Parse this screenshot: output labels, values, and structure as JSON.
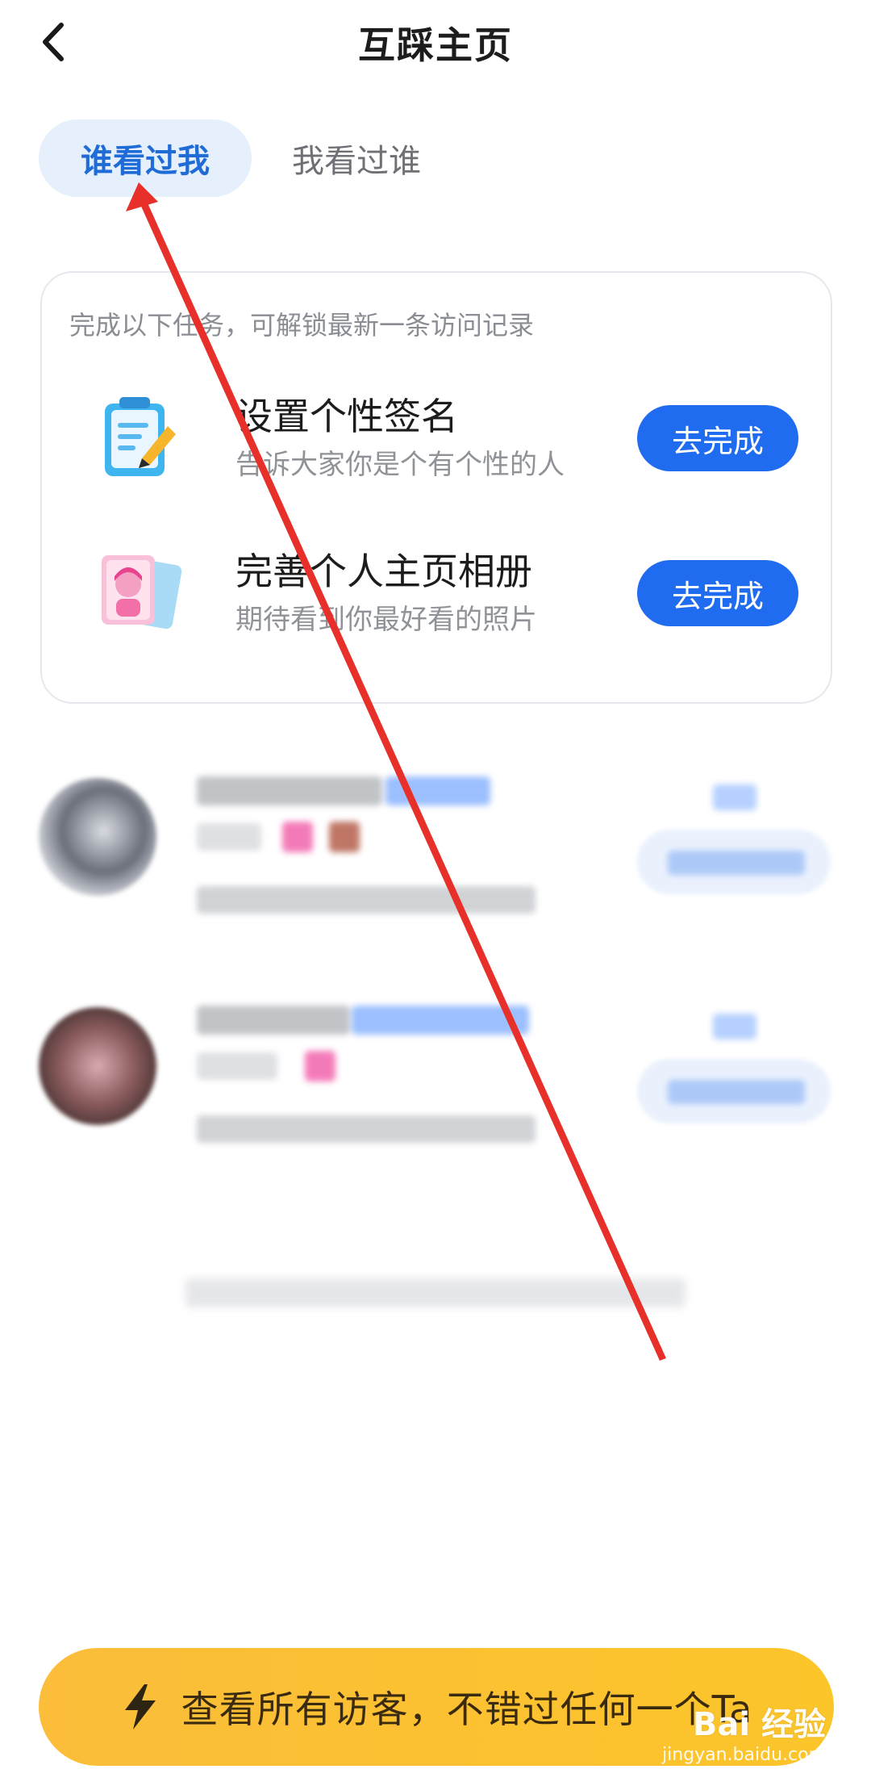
{
  "header": {
    "title": "互踩主页",
    "back_icon": "chevron-left-icon"
  },
  "tabs": [
    {
      "label": "谁看过我",
      "active": true
    },
    {
      "label": "我看过谁",
      "active": false
    }
  ],
  "task_card": {
    "tip": "完成以下任务，可解锁最新一条访问记录",
    "tasks": [
      {
        "title": "设置个性签名",
        "subtitle": "告诉大家你是个有个性的人",
        "button": "去完成",
        "icon": "edit-note-icon"
      },
      {
        "title": "完善个人主页相册",
        "subtitle": "期待看到你最好看的照片",
        "button": "去完成",
        "icon": "photo-album-icon"
      }
    ]
  },
  "cta": {
    "label": "查看所有访客，不错过任何一个Ta",
    "icon": "lightning-icon"
  },
  "watermark": {
    "main": "Bai 经验",
    "sub": "jingyan.baidu.com"
  },
  "colors": {
    "accent": "#1f6cf0",
    "tab_active_bg": "#e6effc",
    "cta": "#fbbd3a",
    "annotation": "#e8302a"
  }
}
